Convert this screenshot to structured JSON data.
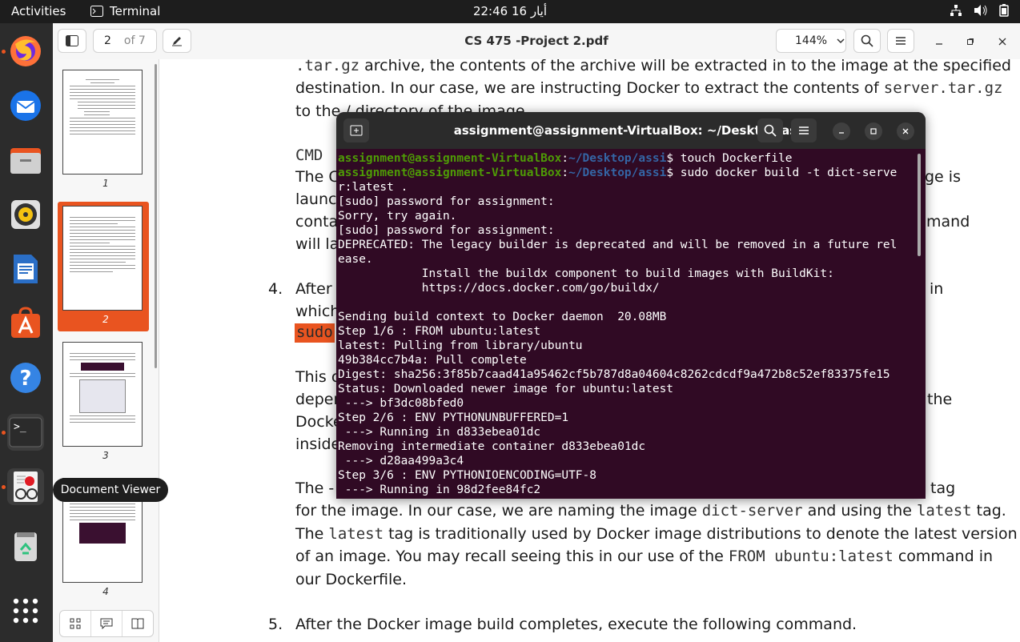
{
  "topbar": {
    "activities": "Activities",
    "app_name": "Terminal",
    "clock": "أيار 16  22:46",
    "tray_icons": [
      "network-icon",
      "volume-icon",
      "battery-icon"
    ]
  },
  "dock": {
    "items": [
      "firefox",
      "thunderbird",
      "files",
      "rhythmbox",
      "libreoffice-writer",
      "software-center",
      "help",
      "terminal",
      "document-viewer",
      "trash",
      "show-apps"
    ],
    "tooltip": "Document Viewer"
  },
  "viewer": {
    "title": "CS 475 -Project 2.pdf",
    "page_current": "2",
    "page_total": "of 7",
    "zoom": "144%"
  },
  "sidebar": {
    "pages": [
      "1",
      "2",
      "3",
      "4"
    ],
    "selected_page": "2"
  },
  "document": {
    "l1_code": ".tar.gz",
    "l1_text": " archive, the contents of the archive will be extracted in to the image at the specified",
    "l2_text": "destination. In our case, we are instructing Docker to extract the contents of ",
    "l2_code": "server.tar.gz",
    "l3_text": "to the / directory of the image.",
    "cmd_code": "CMD",
    "l4_a": "The C",
    "l4_b": "ge is",
    "l5": "launc",
    "l6_a": "conta",
    "l6_b": "mand",
    "l7": "will la",
    "item4_num": "4.",
    "item4_a": "After w",
    "item4_b": "in",
    "item4_c": "which",
    "sudo_code": "sudo",
    "p_a": "This co",
    "p_b": "depen",
    "p_b2": "the",
    "p_c": "Docke",
    "p_d": "inside",
    "t_a": "The -",
    "t_a2": "tag",
    "t_line2_a": "for the image. In our case, we are naming the image ",
    "t_line2_code1": "dict-server",
    "t_line2_b": " and using the ",
    "t_line2_code2": "latest",
    "t_line2_c": " tag.",
    "t_line3_a": "The ",
    "t_line3_code": "latest",
    "t_line3_b": " tag is traditionally used by Docker image distributions to denote the latest version",
    "t_line4_a": "of an image. You may recall seeing this in our use of the ",
    "t_line4_code": "FROM ubuntu:latest",
    "t_line4_b": " command in",
    "t_line5": "our Dockerfile.",
    "item5_num": "5.",
    "item5_text": "After the Docker image build completes, execute the following command."
  },
  "terminal": {
    "title": "assignment@assignment-VirtualBox: ~/Desktop/assi",
    "prompt_user": "assignment@assignment-VirtualBox",
    "prompt_path": "~/Desktop/assi",
    "cmd1": " touch Dockerfile",
    "cmd2": " sudo docker build -t dict-serve",
    "lines": [
      "r:latest .",
      "[sudo] password for assignment:",
      "Sorry, try again.",
      "[sudo] password for assignment:",
      "DEPRECATED: The legacy builder is deprecated and will be removed in a future rel",
      "ease.",
      "            Install the buildx component to build images with BuildKit:",
      "            https://docs.docker.com/go/buildx/",
      "",
      "Sending build context to Docker daemon  20.08MB",
      "Step 1/6 : FROM ubuntu:latest",
      "latest: Pulling from library/ubuntu",
      "49b384cc7b4a: Pull complete",
      "Digest: sha256:3f85b7caad41a95462cf5b787d8a04604c8262cdcdf9a472b8c52ef83375fe15",
      "Status: Downloaded newer image for ubuntu:latest",
      " ---> bf3dc08bfed0",
      "Step 2/6 : ENV PYTHONUNBUFFERED=1",
      " ---> Running in d833ebea01dc",
      "Removing intermediate container d833ebea01dc",
      " ---> d28aa499a3c4",
      "Step 3/6 : ENV PYTHONIOENCODING=UTF-8",
      " ---> Running in 98d2fee84fc2"
    ]
  }
}
